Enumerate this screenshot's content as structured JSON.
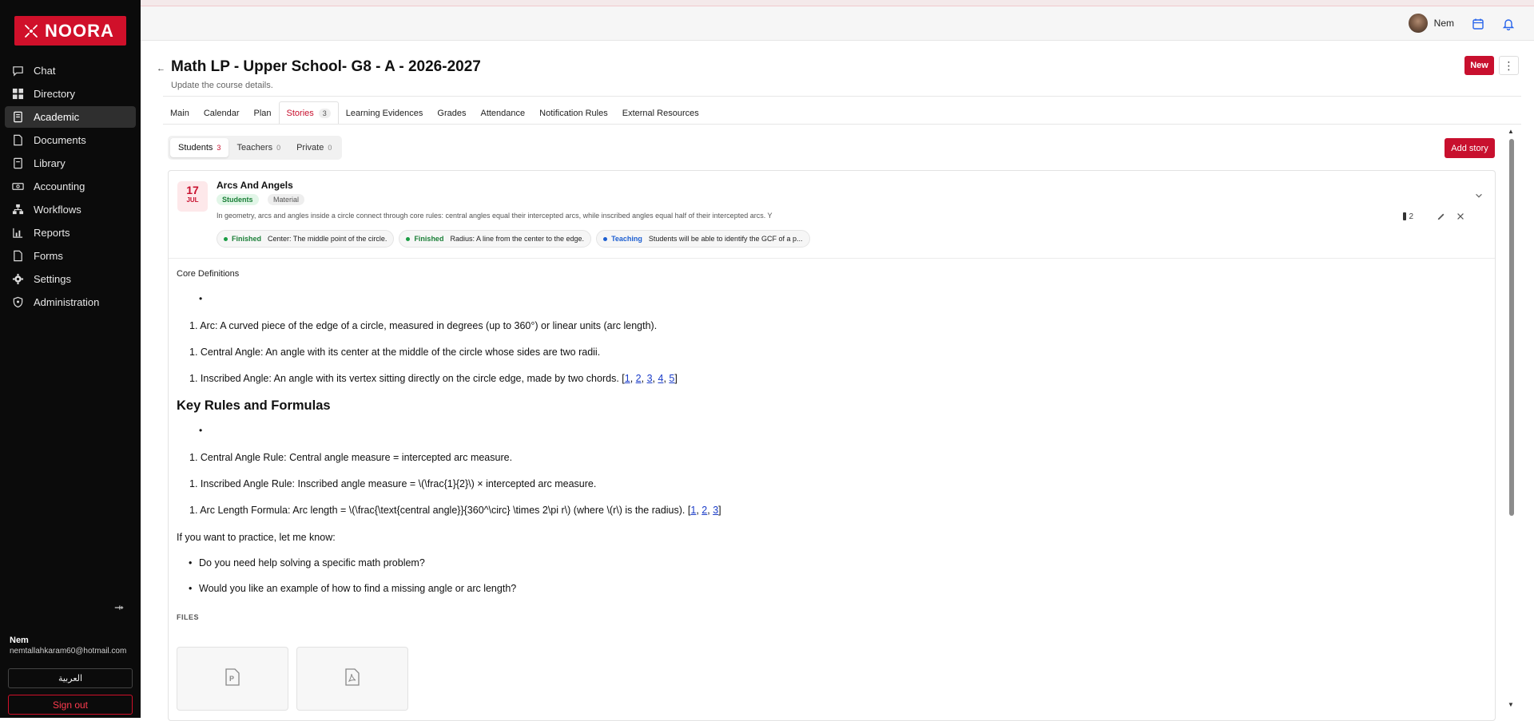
{
  "app": {
    "brand": "NOORA"
  },
  "sidebar": {
    "items": [
      {
        "label": "Chat",
        "icon": "chat-icon"
      },
      {
        "label": "Directory",
        "icon": "grid-icon"
      },
      {
        "label": "Academic",
        "icon": "book-icon",
        "active": true
      },
      {
        "label": "Documents",
        "icon": "document-icon"
      },
      {
        "label": "Library",
        "icon": "library-icon"
      },
      {
        "label": "Accounting",
        "icon": "accounting-icon"
      },
      {
        "label": "Workflows",
        "icon": "workflow-icon"
      },
      {
        "label": "Reports",
        "icon": "reports-icon"
      },
      {
        "label": "Forms",
        "icon": "forms-icon"
      },
      {
        "label": "Settings",
        "icon": "gear-icon"
      },
      {
        "label": "Administration",
        "icon": "shield-icon"
      }
    ],
    "user_name": "Nem",
    "user_email": "nemtallahkaram60@hotmail.com",
    "language_button": "العربية",
    "signout_button": "Sign out"
  },
  "topbar": {
    "user_name": "Nem"
  },
  "page": {
    "title": "Math LP - Upper School- G8 - A - 2026-2027",
    "subtitle": "Update the course details.",
    "new_button": "New",
    "more_button": "⋮"
  },
  "tabs": [
    {
      "label": "Main"
    },
    {
      "label": "Calendar"
    },
    {
      "label": "Plan"
    },
    {
      "label": "Stories",
      "count": "3",
      "active": true
    },
    {
      "label": "Learning Evidences"
    },
    {
      "label": "Grades"
    },
    {
      "label": "Attendance"
    },
    {
      "label": "Notification Rules"
    },
    {
      "label": "External Resources"
    }
  ],
  "subtabs": [
    {
      "label": "Students",
      "count": "3",
      "active": true
    },
    {
      "label": "Teachers",
      "count": "0"
    },
    {
      "label": "Private",
      "count": "0"
    }
  ],
  "add_story_button": "Add story",
  "story": {
    "day": "17",
    "month": "JUL",
    "title": "Arcs And Angels",
    "tag_audience": "Students",
    "tag_type": "Material",
    "description": "In geometry, arcs and angles inside a circle connect through core rules: central angles equal their intercepted arcs, while inscribed angles equal half of their intercepted arcs. Y",
    "chips": [
      {
        "status": "Finished",
        "text": "Center: The middle point of the circle."
      },
      {
        "status": "Finished",
        "text": "Radius: A line from the center to the edge."
      },
      {
        "status": "Teaching",
        "text": "Students will be able to identify the GCF of a p..."
      }
    ],
    "attachment_count": "2"
  },
  "content": {
    "core_definitions": "Core Definitions",
    "defs": [
      "Arc: A curved piece of the edge of a circle, measured in degrees (up to 360°) or linear units (arc length).",
      "Central Angle: An angle with its center at the middle of the circle whose sides are two radii.",
      "Inscribed Angle: An angle with its vertex sitting directly on the circle edge, made by two chords."
    ],
    "defs_refs": [
      "1",
      "2",
      "3",
      "4",
      "5"
    ],
    "section_heading": "Key Rules and Formulas",
    "rules": [
      "Central Angle Rule: Central angle measure = intercepted arc measure.",
      "Inscribed Angle Rule: Inscribed angle measure = \\(\\frac{1}{2}\\) × intercepted arc measure.",
      "Arc Length Formula: Arc length = \\(\\frac{\\text{central angle}}{360^\\circ} \\times 2\\pi r\\) (where \\(r\\) is the radius)."
    ],
    "rules_refs": [
      "1",
      "2",
      "3"
    ],
    "practice_intro": "If you want to practice, let me know:",
    "questions": [
      "Do you need help solving a specific math problem?",
      "Would you like an example of how to find a missing angle or arc length?"
    ],
    "files_label": "FILES"
  },
  "colors": {
    "brand_red": "#c8102e",
    "sidebar_bg": "#0b0b0b",
    "finished_green": "#1a7f37",
    "teaching_blue": "#1d5fd1"
  }
}
